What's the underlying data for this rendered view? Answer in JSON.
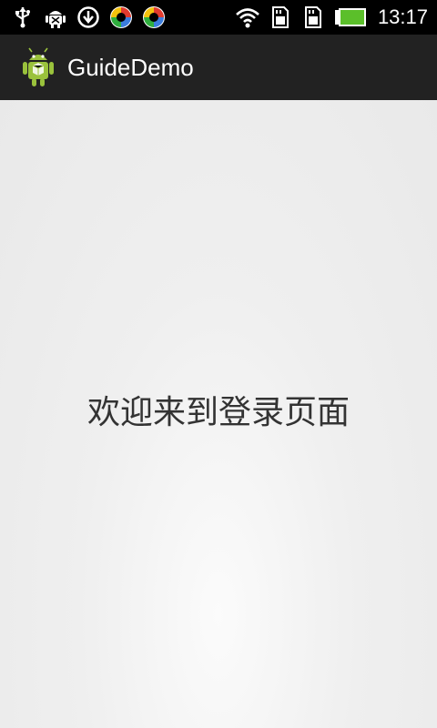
{
  "status_bar": {
    "time": "13:17",
    "left_icons": [
      "usb-icon",
      "android-debug-icon",
      "download-icon",
      "sync-app-icon",
      "sync-app-icon"
    ],
    "right_icons": [
      "wifi-icon",
      "sd-card-icon",
      "sd-card-icon",
      "battery-icon"
    ]
  },
  "action_bar": {
    "app_title": "GuideDemo",
    "app_icon": "android-icon"
  },
  "content": {
    "welcome_text": "欢迎来到登录页面"
  },
  "colors": {
    "status_bar_bg": "#000000",
    "action_bar_bg": "#222222",
    "content_bg": "#eeeeee",
    "text": "#333333",
    "battery_green": "#5bbf2a",
    "android_green": "#9ac23c"
  }
}
